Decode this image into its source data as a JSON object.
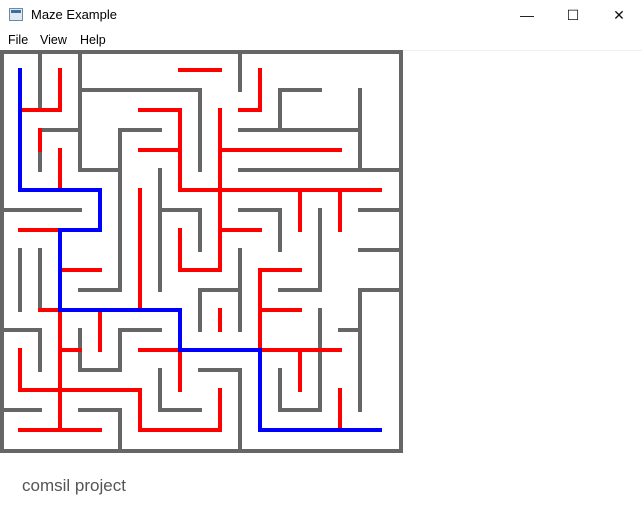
{
  "window": {
    "title": "Maze Example"
  },
  "window_controls": {
    "minimize": "—",
    "maximize": "☐",
    "close": "✕"
  },
  "menu": {
    "items": [
      "File",
      "View",
      "Help"
    ]
  },
  "maze": {
    "colors": {
      "wall": "#666666",
      "visited": "#ff0000",
      "solution": "#0000ff"
    }
  },
  "footer": {
    "text": "comsil project"
  }
}
